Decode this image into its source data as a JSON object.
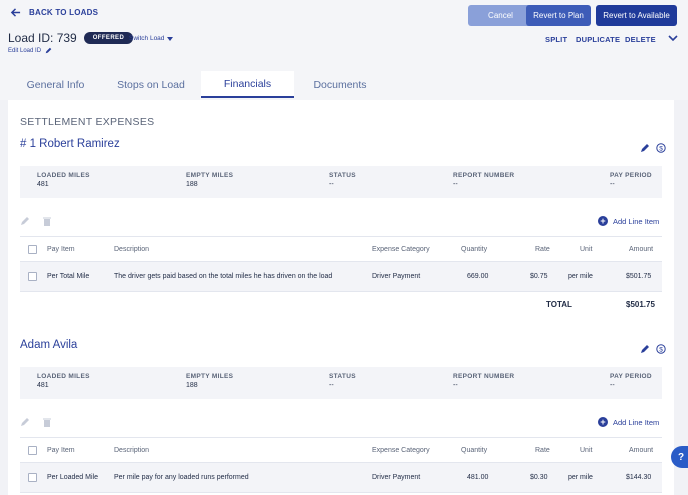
{
  "nav": {
    "back_label": "BACK TO LOADS"
  },
  "header": {
    "buttons": {
      "cancel": "Cancel",
      "revert_plan": "Revert to Plan",
      "revert_available": "Revert to Available"
    },
    "load_title": "Load ID: 739",
    "status_badge": "OFFERED",
    "switch_load": "Switch Load",
    "edit_load_id": "Edit Load ID",
    "actions": {
      "split": "SPLIT",
      "duplicate": "DUPLICATE",
      "delete": "DELETE"
    }
  },
  "tabs": [
    {
      "label": "General Info",
      "active": false
    },
    {
      "label": "Stops on Load",
      "active": false
    },
    {
      "label": "Financials",
      "active": true
    },
    {
      "label": "Documents",
      "active": false
    }
  ],
  "section_title": "SETTLEMENT EXPENSES",
  "add_line_item": "Add Line Item",
  "table_headers": {
    "pay_item": "Pay Item",
    "description": "Description",
    "expense_category": "Expense Category",
    "quantity": "Quantity",
    "rate": "Rate",
    "unit": "Unit",
    "amount": "Amount"
  },
  "stat_labels": {
    "loaded": "LOADED MILES",
    "empty": "EMPTY MILES",
    "status": "STATUS",
    "report": "REPORT NUMBER",
    "pay_period": "PAY PERIOD"
  },
  "drivers": [
    {
      "name": "# 1 Robert Ramirez",
      "stats": {
        "loaded": "481",
        "empty": "188",
        "status": "--",
        "report": "--",
        "pay_period": "--"
      },
      "row": {
        "pay_item": "Per Total Mile",
        "description": "The driver gets paid based on the total miles he has driven on the load",
        "expense_category": "Driver Payment",
        "quantity": "669.00",
        "rate": "$0.75",
        "unit": "per mile",
        "amount": "$501.75"
      },
      "total_label": "TOTAL",
      "total_value": "$501.75"
    },
    {
      "name": "Adam Avila",
      "stats": {
        "loaded": "481",
        "empty": "188",
        "status": "--",
        "report": "--",
        "pay_period": "--"
      },
      "row": {
        "pay_item": "Per Loaded Mile",
        "description": "Per mile pay for any loaded runs performed",
        "expense_category": "Driver Payment",
        "quantity": "481.00",
        "rate": "$0.30",
        "unit": "per mile",
        "amount": "$144.30"
      }
    }
  ],
  "colors": {
    "primary": "#2a3f9a",
    "cancel": "#8aa0d9",
    "badge": "#1f2a55",
    "muted_bg": "#f3f4f8"
  },
  "help_label": "?"
}
